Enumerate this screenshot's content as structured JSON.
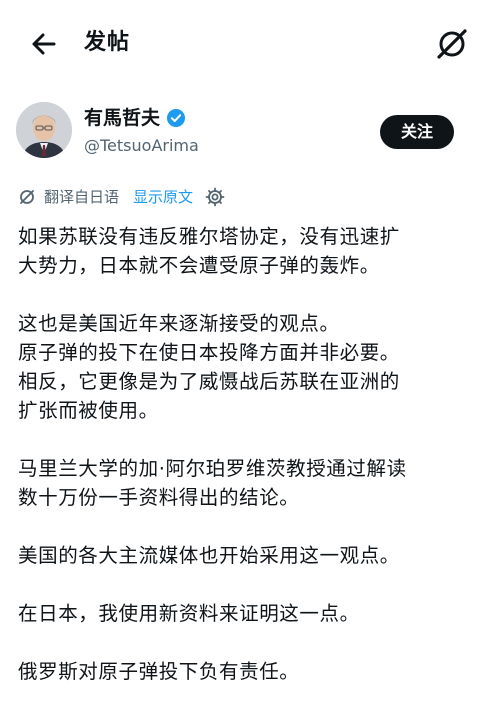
{
  "header": {
    "title": "发帖"
  },
  "author": {
    "display_name": "有馬哲夫",
    "handle": "@TetsuoArima",
    "verified": true,
    "avatar_icon": "person-portrait",
    "follow_label": "关注"
  },
  "translation": {
    "label": "翻译自日语",
    "show_original_label": "显示原文"
  },
  "tweet": {
    "paragraphs": [
      [
        "如果苏联没有违反雅尔塔协定，没有迅速扩",
        "大势力，日本就不会遭受原子弹的轰炸。"
      ],
      [
        "这也是美国近年来逐渐接受的观点。",
        "原子弹的投下在使日本投降方面并非必要。",
        "相反，它更像是为了威慑战后苏联在亚洲的",
        "扩张而被使用。"
      ],
      [
        "马里兰大学的加·阿尔珀罗维茨教授通过解读",
        "数十万份一手资料得出的结论。"
      ],
      [
        "美国的各大主流媒体也开始采用这一观点。"
      ],
      [
        "在日本，我使用新资料来证明这一点。"
      ],
      [
        "俄罗斯对原子弹投下负有责任。"
      ]
    ]
  },
  "colors": {
    "text": "#0f1419",
    "secondary": "#536471",
    "link": "#1d9bf0",
    "follow_bg": "#0f1419"
  }
}
